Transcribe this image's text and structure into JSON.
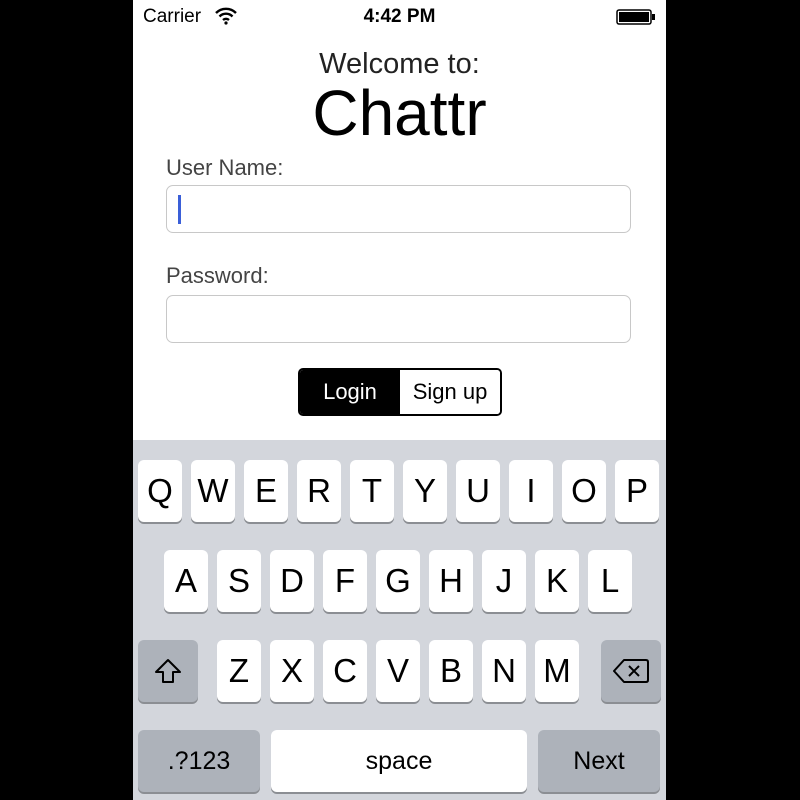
{
  "status_bar": {
    "carrier": "Carrier",
    "time": "4:42 PM"
  },
  "form": {
    "welcome": "Welcome to:",
    "app_title": "Chattr",
    "username_label": "User Name:",
    "username_value": "",
    "password_label": "Password:",
    "password_value": "",
    "segments": {
      "login": "Login",
      "signup": "Sign up",
      "selected": "Login"
    }
  },
  "keyboard": {
    "row1": [
      "Q",
      "W",
      "E",
      "R",
      "T",
      "Y",
      "U",
      "I",
      "O",
      "P"
    ],
    "row2": [
      "A",
      "S",
      "D",
      "F",
      "G",
      "H",
      "J",
      "K",
      "L"
    ],
    "row3": [
      "Z",
      "X",
      "C",
      "V",
      "B",
      "N",
      "M"
    ],
    "shift_icon": "shift-icon",
    "delete_icon": "backspace-icon",
    "numbers_label": ".?123",
    "space_label": "space",
    "return_label": "Next"
  },
  "colors": {
    "cursor": "#3a5fd8",
    "keyboard_bg": "#d3d6dc",
    "segment_selected": "#000000"
  }
}
